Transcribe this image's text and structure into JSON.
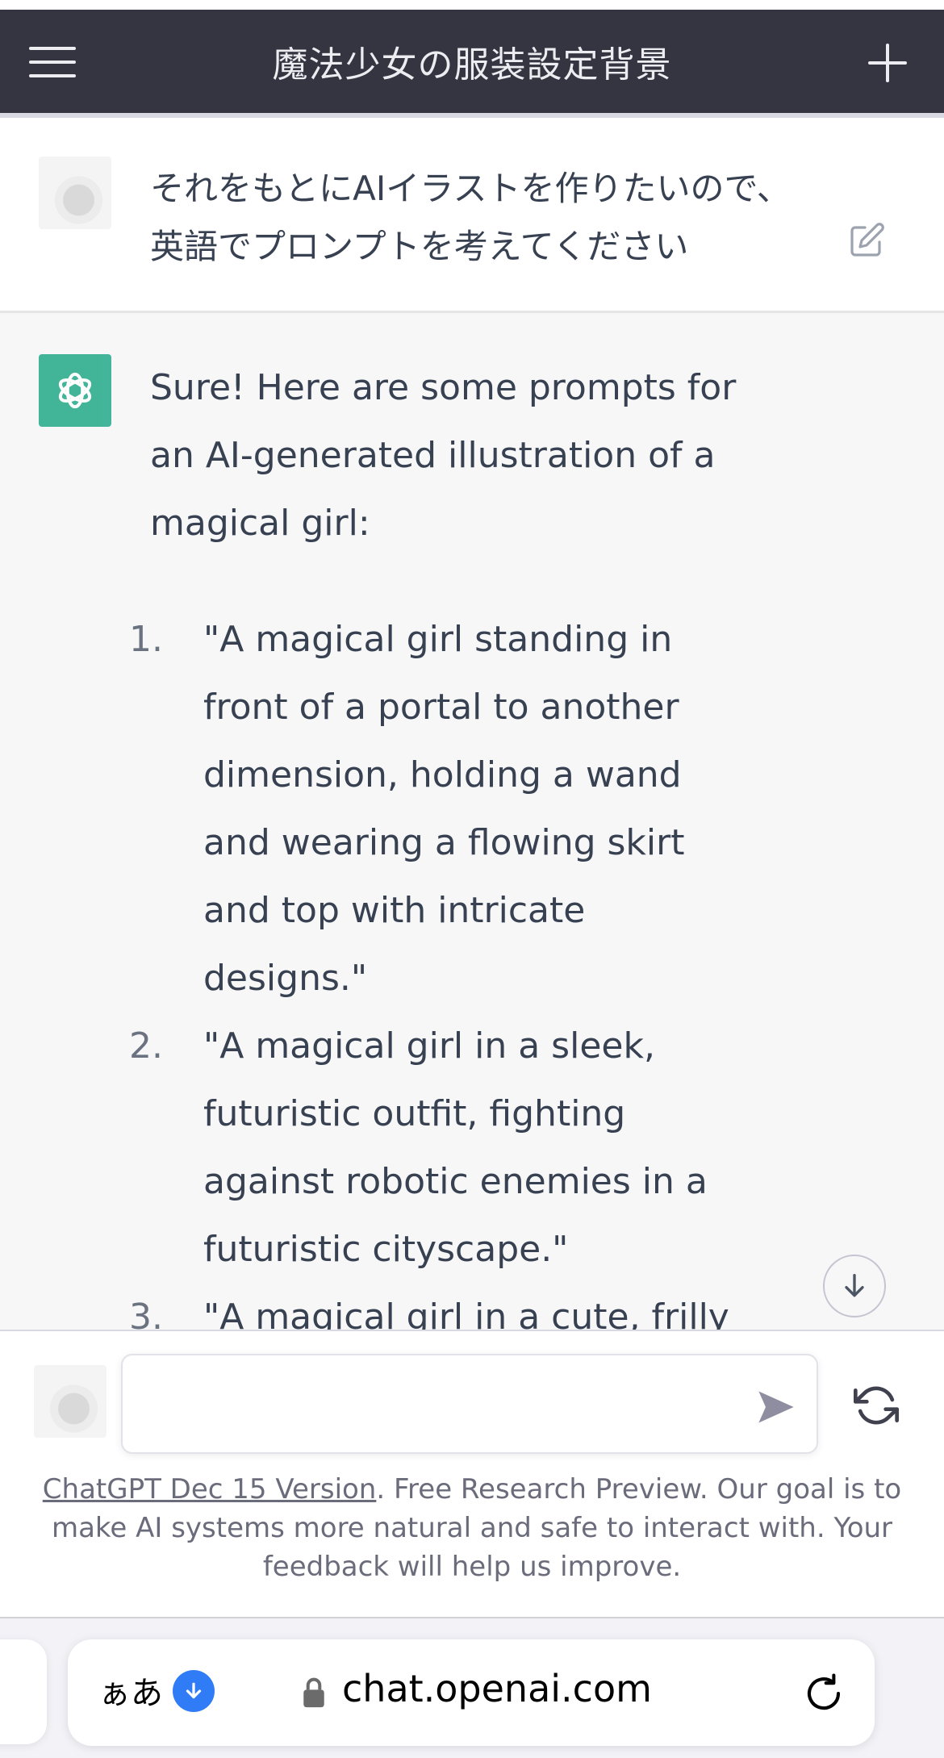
{
  "header": {
    "title": "魔法少女の服装設定背景",
    "menu_icon": "hamburger-menu-icon",
    "new_chat_icon": "plus-icon"
  },
  "user_message": {
    "lines": [
      "それをもとにAIイラストを作りたいので、",
      "英語でプロンプトを考えてください"
    ],
    "edit_icon": "edit-icon"
  },
  "assistant_message": {
    "intro_lines": [
      "Sure! Here are some prompts for",
      "an AI-generated illustration of a",
      "magical girl:"
    ],
    "items": [
      {
        "number": "1.",
        "lines": [
          "\"A magical girl standing in",
          "front of a portal to another",
          "dimension, holding a wand",
          "and wearing a flowing skirt",
          "and top with intricate",
          "designs.\""
        ]
      },
      {
        "number": "2.",
        "lines": [
          "\"A magical girl in a sleek,",
          "futuristic outfit, fighting",
          "against robotic enemies in a",
          "futuristic cityscape.\""
        ]
      },
      {
        "number": "3.",
        "lines": [
          "\"A magical girl in a cute, frilly"
        ]
      }
    ]
  },
  "composer": {
    "input_value": "",
    "input_placeholder": "",
    "send_icon": "send-icon",
    "regenerate_icon": "regenerate-icon",
    "scroll_icon": "arrow-down-icon"
  },
  "disclaimer": {
    "link_text": "ChatGPT Dec 15 Version",
    "text": ". Free Research Preview. Our goal is to make AI systems more natural and safe to interact with. Your feedback will help us improve."
  },
  "browser": {
    "aa_label": "ぁあ",
    "url": "chat.openai.com"
  },
  "colors": {
    "header_bg": "#343541",
    "assistant_bg": "#f7f7f8",
    "gpt_green": "#10a37f",
    "download_blue": "#2f7cf6"
  }
}
